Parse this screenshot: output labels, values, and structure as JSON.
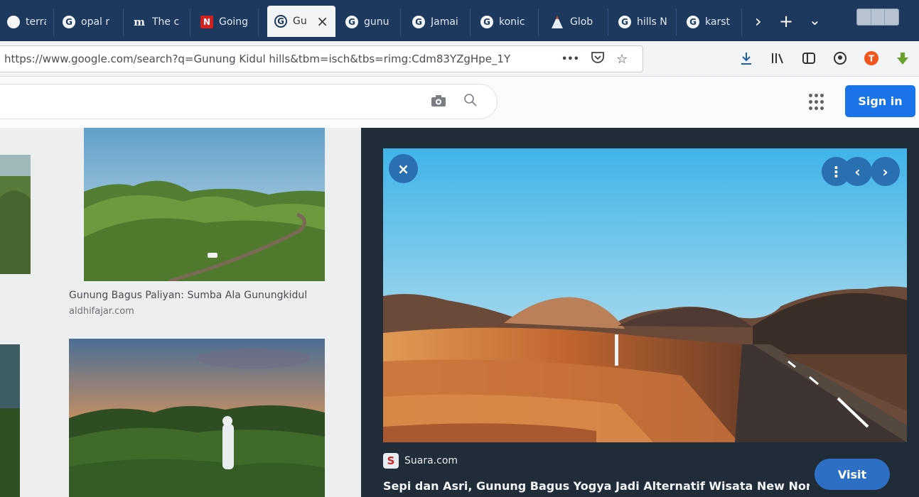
{
  "browser": {
    "tabs": [
      {
        "title": "terras",
        "favicon": "circle-icon"
      },
      {
        "title": "opal r",
        "favicon": "google-icon"
      },
      {
        "title": "The c",
        "favicon": "m-logo-icon"
      },
      {
        "title": "Going",
        "favicon": "n-logo-icon"
      },
      {
        "title": "Gu",
        "favicon": "google-icon",
        "active": true
      },
      {
        "title": "gunu",
        "favicon": "google-icon"
      },
      {
        "title": "Jamai",
        "favicon": "google-icon"
      },
      {
        "title": "konic",
        "favicon": "google-icon"
      },
      {
        "title": "Glob",
        "favicon": "volcano-icon"
      },
      {
        "title": "hills N",
        "favicon": "google-icon"
      },
      {
        "title": "karst",
        "favicon": "google-icon"
      }
    ],
    "close_glyph": "×",
    "overflow_glyph": "›",
    "new_tab_glyph": "+",
    "list_tabs_glyph": "⌄",
    "url": "https://www.google.com/search?q=Gunung Kidul hills&tbm=isch&tbs=rimg:Cdm83YZgHpe_1Y",
    "url_icons": [
      "more-icon",
      "pocket-icon",
      "star-icon"
    ],
    "url_more_glyph": "•••",
    "toolbar_icons": [
      "download-icon",
      "library-icon",
      "sidebar-icon",
      "account-icon",
      "extension-t-icon",
      "extension-leaf-icon"
    ]
  },
  "google": {
    "sign_in_label": "Sign in",
    "camera_icon": "camera-icon",
    "search_icon": "search-icon",
    "apps_icon": "apps-grid-icon"
  },
  "results": {
    "items": [
      {
        "title": "Gunung Bagus Paliyan: Sumba Ala Gunungkidul",
        "source": "aldhifajar.com"
      }
    ]
  },
  "preview": {
    "source_name": "Suara.com",
    "source_logo_letter": "S",
    "title": "Sepi dan Asri, Gunung Bagus Yogya Jadi Alternatif Wisata New Nor...",
    "visit_label": "Visit",
    "close_glyph": "×",
    "more_glyph": "⋮",
    "prev_glyph": "‹",
    "next_glyph": "›"
  },
  "colors": {
    "tabstrip": "#1d3a5e",
    "sign_in": "#1a73e8",
    "panel": "#202c38",
    "visit": "#2d6fc4"
  }
}
